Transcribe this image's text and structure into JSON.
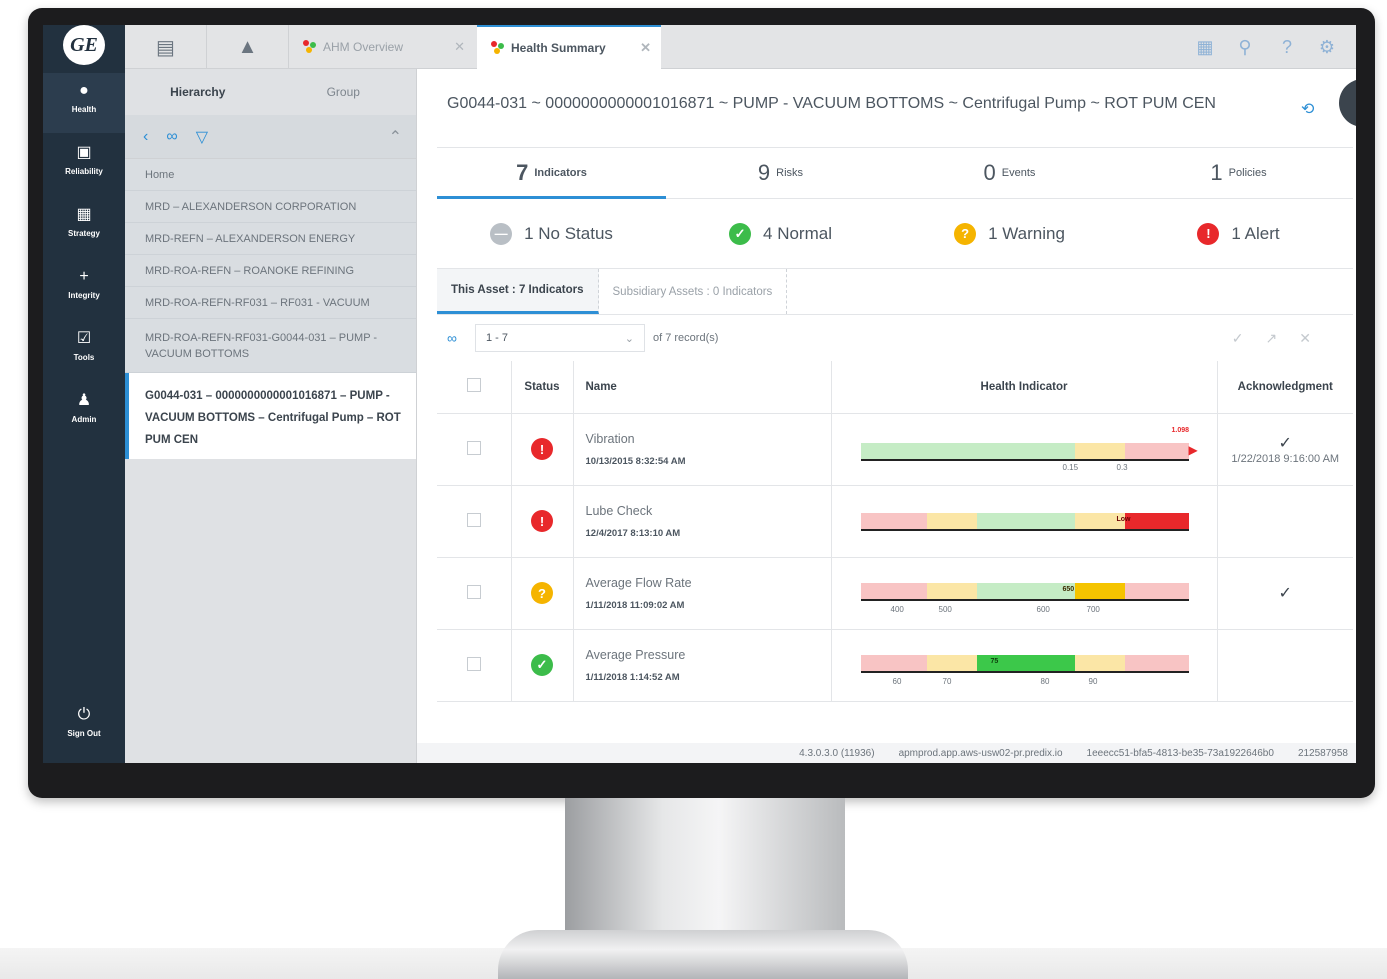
{
  "nav": {
    "logo": "GE",
    "items": [
      {
        "label": "Health",
        "icon": "●"
      },
      {
        "label": "Reliability",
        "icon": "▣"
      },
      {
        "label": "Strategy",
        "icon": "▦"
      },
      {
        "label": "Integrity",
        "icon": "+"
      },
      {
        "label": "Tools",
        "icon": "☑"
      },
      {
        "label": "Admin",
        "icon": "♟"
      }
    ],
    "signout": {
      "label": "Sign Out",
      "icon": "⏻"
    }
  },
  "tabs": {
    "t1": "AHM Overview",
    "t2": "Health Summary"
  },
  "hierarchy": {
    "tab_hierarchy": "Hierarchy",
    "tab_group": "Group",
    "rows": [
      "Home",
      "MRD – ALEXANDERSON CORPORATION",
      "MRD-REFN – ALEXANDERSON ENERGY",
      "MRD-ROA-REFN – ROANOKE REFINING",
      "MRD-ROA-REFN-RF031 – RF031 - VACUUM",
      "MRD-ROA-REFN-RF031-G0044-031 – PUMP - VACUUM BOTTOMS"
    ],
    "selected": "G0044-031 – 0000000000001016871 – PUMP - VACUUM BOTTOMS – Centrifugal Pump – ROT PUM CEN"
  },
  "main": {
    "title": "G0044-031 ~ 0000000000001016871 ~ PUMP - VACUUM BOTTOMS ~ Centrifugal Pump ~ ROT PUM CEN",
    "counts": [
      {
        "n": "7",
        "label": "Indicators"
      },
      {
        "n": "9",
        "label": "Risks"
      },
      {
        "n": "0",
        "label": "Events"
      },
      {
        "n": "1",
        "label": "Policies"
      }
    ],
    "statuses": [
      {
        "text": "1 No Status",
        "color": "#b9bfc5",
        "sym": "—"
      },
      {
        "text": "4 Normal",
        "color": "#3cbc4a",
        "sym": "✓"
      },
      {
        "text": "1 Warning",
        "color": "#f5b400",
        "sym": "?"
      },
      {
        "text": "1 Alert",
        "color": "#e8282b",
        "sym": "!"
      }
    ],
    "subtabs": {
      "this": "This Asset : 7 Indicators",
      "sub": "Subsidiary Assets : 0 Indicators"
    },
    "pager": {
      "range": "1 - 7",
      "records": "of 7 record(s)"
    },
    "columns": {
      "status": "Status",
      "name": "Name",
      "health": "Health Indicator",
      "ack": "Acknowledgment"
    },
    "rows": [
      {
        "name": "Vibration",
        "date": "10/13/2015 8:32:54 AM",
        "status": "#e8282b",
        "sym": "!",
        "ack": "1/22/2018 9:16:00 AM",
        "ackcheck": "✓",
        "value": "1.098",
        "ticks": [
          "0.15",
          "0.3"
        ]
      },
      {
        "name": "Lube Check",
        "date": "12/4/2017 8:13:10 AM",
        "status": "#e8282b",
        "sym": "!",
        "ack": "",
        "ackcheck": "",
        "value": "Low",
        "ticks": []
      },
      {
        "name": "Average Flow Rate",
        "date": "1/11/2018 11:09:02 AM",
        "status": "#f5b400",
        "sym": "?",
        "ack": "",
        "ackcheck": "✓",
        "value": "650",
        "ticks": [
          "400",
          "500",
          "600",
          "700"
        ]
      },
      {
        "name": "Average Pressure",
        "date": "1/11/2018 1:14:52 AM",
        "status": "#3cbc4a",
        "sym": "✓",
        "ack": "",
        "ackcheck": "",
        "value": "75",
        "ticks": [
          "60",
          "70",
          "80",
          "90"
        ]
      }
    ]
  },
  "footer": {
    "version": "4.3.0.3.0 (11936)",
    "host": "apmprod.app.aws-usw02-pr.predix.io",
    "id": "1eeecc51-bfa5-4813-be35-73a1922646b0",
    "num": "212587958"
  }
}
